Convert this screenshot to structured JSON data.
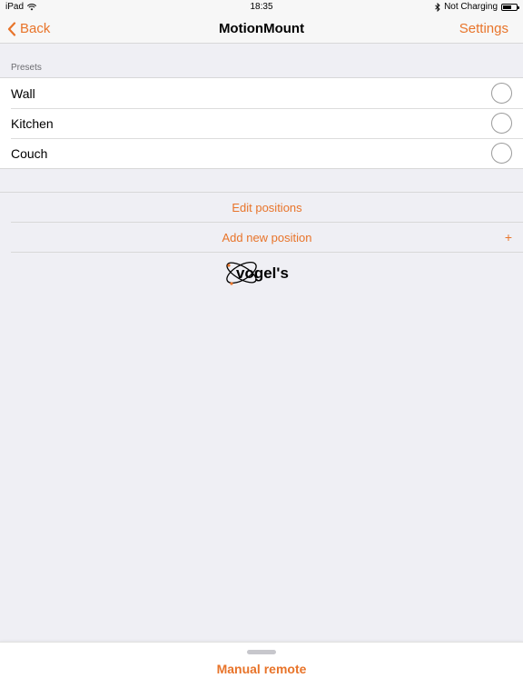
{
  "status_bar": {
    "device": "iPad",
    "time": "18:35",
    "charging": "Not Charging",
    "battery_level": 0.65
  },
  "nav": {
    "back_label": "Back",
    "title": "MotionMount",
    "settings_label": "Settings"
  },
  "presets": {
    "header": "Presets",
    "items": [
      {
        "label": "Wall",
        "selected": false
      },
      {
        "label": "Kitchen",
        "selected": false
      },
      {
        "label": "Couch",
        "selected": false
      }
    ]
  },
  "actions": {
    "edit_label": "Edit positions",
    "add_label": "Add new position",
    "add_icon": "+"
  },
  "logo": {
    "text": "vogel's",
    "icon": "vogels-logo"
  },
  "bottom": {
    "manual_remote_label": "Manual remote"
  },
  "colors": {
    "accent": "#e8742a",
    "background": "#efeff4"
  }
}
